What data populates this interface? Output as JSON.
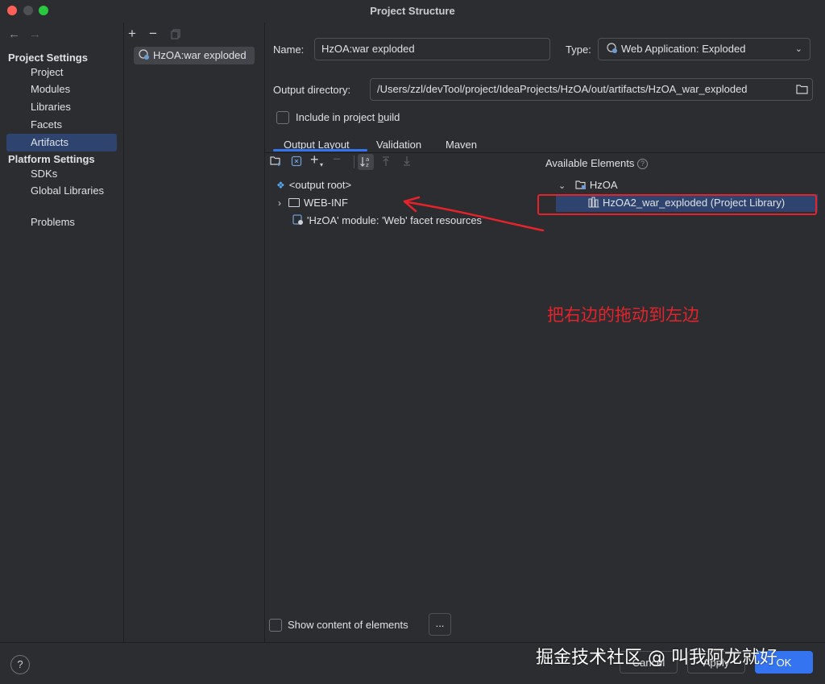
{
  "window": {
    "title": "Project Structure",
    "traffic_lights": {
      "close": "#ff5f57",
      "minimize": "#febc2e",
      "zoom": "#28c840"
    }
  },
  "nav": {
    "back_icon": "arrow-left-icon",
    "forward_icon": "arrow-right-icon",
    "project_settings_header": "Project Settings",
    "project_items": [
      "Project",
      "Modules",
      "Libraries",
      "Facets",
      "Artifacts"
    ],
    "selected": "Artifacts",
    "platform_settings_header": "Platform Settings",
    "platform_items": [
      "SDKs",
      "Global Libraries"
    ],
    "problems": "Problems"
  },
  "artifact_list": {
    "add_symbol": "+",
    "remove_symbol": "−",
    "copy_icon": "copy-icon",
    "items": [
      "HzOA:war exploded"
    ]
  },
  "form": {
    "name_label": "Name:",
    "name_value": "HzOA:war exploded",
    "type_label": "Type:",
    "type_value": "Web Application: Exploded",
    "output_dir_label": "Output directory:",
    "output_dir_value": "/Users/zzl/devTool/project/IdeaProjects/HzOA/out/artifacts/HzOA_war_exploded",
    "include_build_prefix": "Include in project ",
    "include_build_underlined": "b",
    "include_build_suffix": "uild",
    "include_build_checked": false
  },
  "tabs": [
    "Output Layout",
    "Validation",
    "Maven"
  ],
  "active_tab": "Output Layout",
  "layout_tree": {
    "root": "<output root>",
    "webinf": "WEB-INF",
    "facet": "'HzOA' module: 'Web' facet resources"
  },
  "available": {
    "header": "Available Elements",
    "module": "HzOA",
    "library": "HzOA2_war_exploded (Project Library)"
  },
  "annotation": "把右边的拖动到左边",
  "show_content": {
    "label": "Show content of elements",
    "checked": false,
    "more": "..."
  },
  "footer": {
    "help": "?",
    "cancel": "Cancel",
    "apply": "Apply",
    "ok": "OK",
    "watermark": "掘金技术社区 @ 叫我阿龙就好"
  },
  "colors": {
    "accent": "#3574f0",
    "selection": "#2e436e",
    "annotation": "#e5232b"
  }
}
